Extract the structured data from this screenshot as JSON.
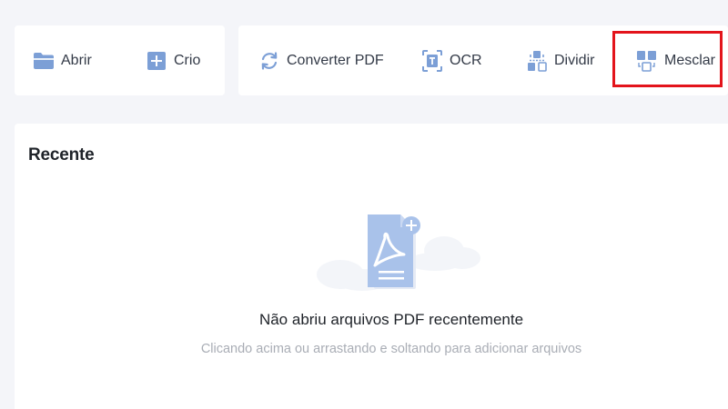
{
  "toolbar": {
    "open_label": "Abrir",
    "create_label": "Crio",
    "convert_label": "Converter PDF",
    "ocr_label": "OCR",
    "split_label": "Dividir",
    "merge_label": "Mesclar",
    "highlighted_tool": "Mesclar",
    "highlight_color": "#e3141b",
    "icon_color": "#7c9fd6",
    "icons": {
      "open": "folder-icon",
      "create": "plus-square-icon",
      "convert": "convert-arrows-icon",
      "ocr": "ocr-scan-icon",
      "split": "split-icon",
      "merge": "merge-icon"
    }
  },
  "recent": {
    "title": "Recente",
    "empty_title": "Não abriu arquivos PDF recentemente",
    "empty_hint": "Clicando acima ou arrastando e soltando para adicionar arquivos",
    "illustration_icon": "empty-pdf-document-icon"
  }
}
